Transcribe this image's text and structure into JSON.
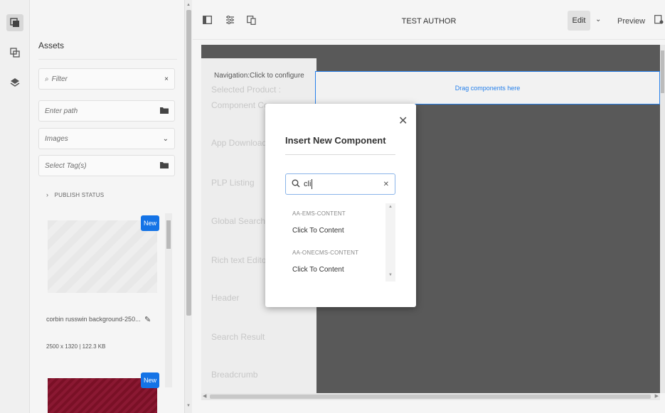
{
  "rail": {
    "icons": [
      "assets-icon",
      "components-icon",
      "layers-icon"
    ]
  },
  "assets": {
    "title": "Assets",
    "filter_placeholder": "Filter",
    "filter_clear": "×",
    "path_placeholder": "Enter path",
    "type_value": "Images",
    "tags_placeholder": "Select Tag(s)",
    "publish_status": "PUBLISH STATUS",
    "cards": [
      {
        "badge": "New",
        "name": "corbin russwin background-250...",
        "meta": "2500 x 1320 | 122.3 KB"
      },
      {
        "badge": "New"
      }
    ]
  },
  "topbar": {
    "title": "TEST AUTHOR",
    "edit_label": "Edit",
    "preview_label": "Preview"
  },
  "canvas": {
    "nav_head": "Navigation:Click to configure",
    "drop_zone": "Drag components here",
    "nav_items": [
      "Selected Product :",
      "Component Co",
      "App Download",
      "PLP Listing",
      "Global Search",
      "Rich text Editor",
      "Header",
      "Search Result",
      "Breadcrumb"
    ]
  },
  "modal": {
    "title": "Insert New Component",
    "search_value": "cli",
    "results": [
      {
        "group": "AA-EMS-CONTENT",
        "item": "Click To Content"
      },
      {
        "group": "AA-ONECMS-CONTENT",
        "item": "Click To Content"
      }
    ]
  },
  "colors": {
    "accent": "#1473e6",
    "canvas": "#595959"
  }
}
